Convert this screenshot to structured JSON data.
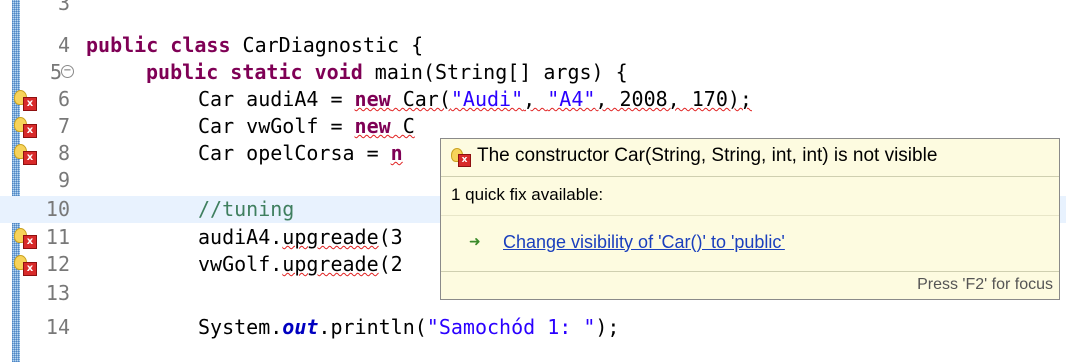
{
  "editor": {
    "lines": [
      {
        "num": "3"
      },
      {
        "num": "4"
      },
      {
        "num": "5"
      },
      {
        "num": "6"
      },
      {
        "num": "7"
      },
      {
        "num": "8"
      },
      {
        "num": "9"
      },
      {
        "num": "10"
      },
      {
        "num": "11"
      },
      {
        "num": "12"
      },
      {
        "num": "13"
      },
      {
        "num": "14"
      }
    ],
    "code": {
      "l4_kw": "public class",
      "l4_rest": " CarDiagnostic {",
      "l5_kw": "public static void",
      "l5_rest": " main(String[] args) {",
      "l6_a": "Car audiA4 = ",
      "l6_kw": "new",
      "l6_b": " Car(",
      "l6_s1": "\"Audi\"",
      "l6_c": ", ",
      "l6_s2": "\"A4\"",
      "l6_d": ", 2008, 170);",
      "l7_a": "Car vwGolf = ",
      "l7_kw": "new",
      "l7_b": " C",
      "l8_a": "Car opelCorsa = ",
      "l8_kw": "n",
      "l10_cmt": "//tuning",
      "l11_a": "audiA4.",
      "l11_err": "upgreade",
      "l11_b": "(3",
      "l12_a": "vwGolf.",
      "l12_err": "upgreade",
      "l12_b": "(2",
      "l14_a": "System.",
      "l14_fld": "out",
      "l14_b": ".println(",
      "l14_str": "\"Samochód 1: \"",
      "l14_c": ");"
    }
  },
  "popup": {
    "title": "The constructor Car(String, String, int, int) is not visible",
    "subtitle": "1 quick fix available:",
    "fix_label": "Change visibility of 'Car()' to 'public'",
    "focus_hint": "Press 'F2' for focus"
  },
  "icons": {
    "problem_marker": "lightbulb-error-icon",
    "fold": "fold-collapse-icon",
    "fix": "quick-fix-arrow-icon"
  }
}
